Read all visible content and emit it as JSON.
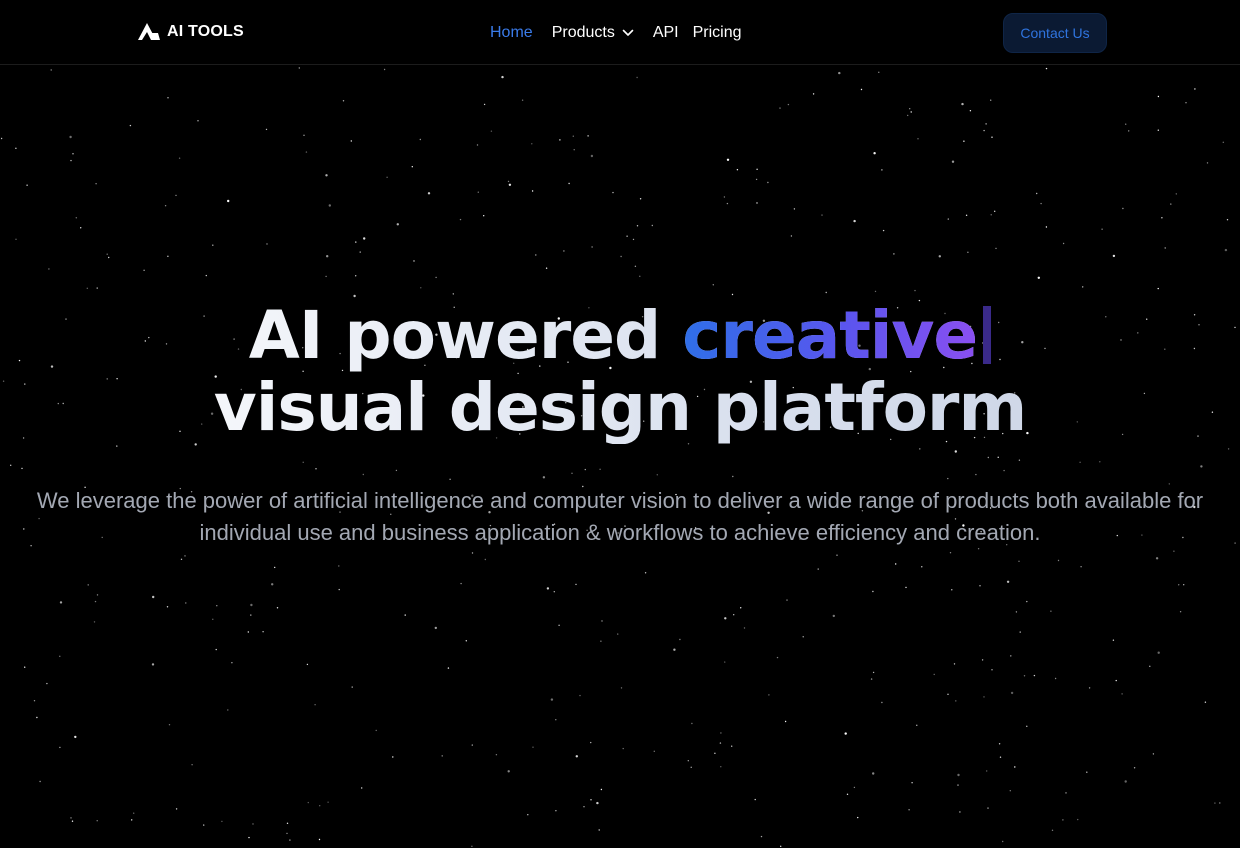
{
  "brand": {
    "name": "AI TOOLS",
    "logo_icon": "triangle-logo-icon"
  },
  "nav": {
    "items": [
      {
        "label": "Home",
        "active": true
      },
      {
        "label": "Products",
        "has_dropdown": true,
        "icon": "chevron-down-icon"
      },
      {
        "label": "API"
      },
      {
        "label": "Pricing"
      }
    ],
    "contact_label": "Contact Us"
  },
  "hero": {
    "title_line1_prefix": "AI powered ",
    "title_line1_accent": "creative",
    "title_line2": "visual design platform",
    "subtitle": "We leverage the power of artificial intelligence and computer vision to deliver a wide range of products both available for individual use and business application & workflows to achieve efficiency and creation."
  },
  "colors": {
    "background": "#000000",
    "nav_active": "#3a7bea",
    "accent_gradient_start": "#2f6fe8",
    "accent_gradient_end": "#8a4ff0",
    "contact_bg": "#0b1a33",
    "contact_text": "#2f74df",
    "subtitle_text": "#a3a8b3"
  }
}
